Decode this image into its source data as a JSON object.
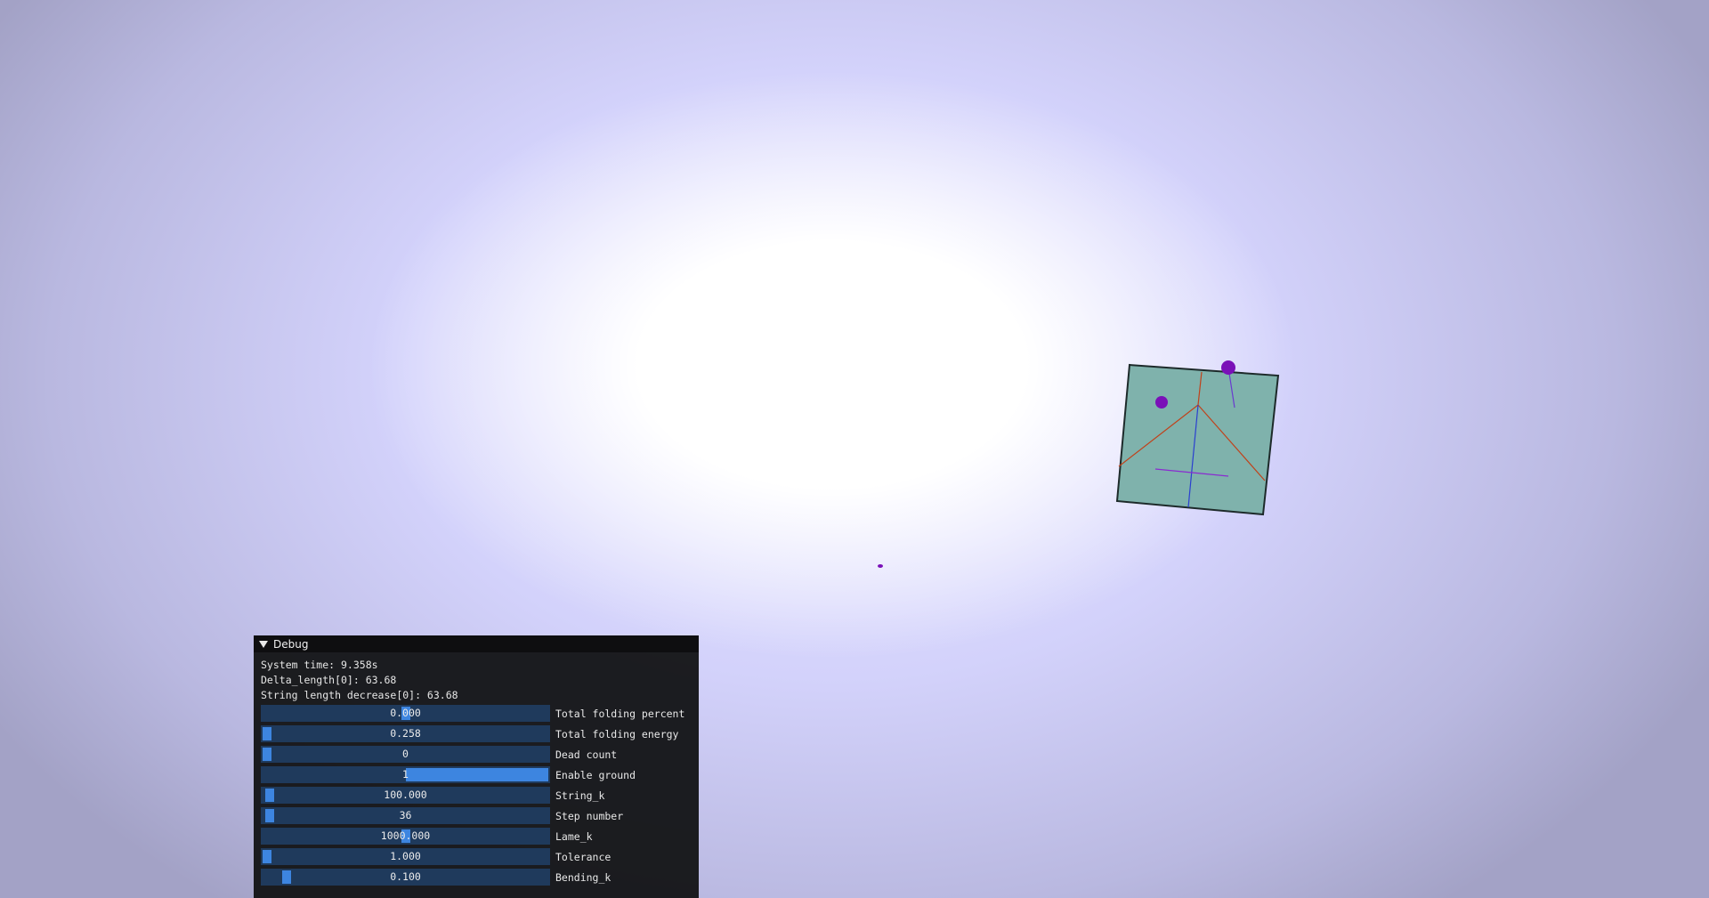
{
  "scene": {
    "background_center": "#ffffff",
    "background_edge": "#a3a2c6",
    "cloth_color": "#7fb2ac",
    "sphere_color": "#7a10b8",
    "fold_line_colors": [
      "#c0421b",
      "#2a3fd0",
      "#8a2bd0"
    ]
  },
  "debug": {
    "title": "Debug",
    "info": {
      "system_time": "System time: 9.358s",
      "delta_length": "Delta_length[0]: 63.68",
      "string_length_decrease": "String length decrease[0]: 63.68"
    },
    "sliders": [
      {
        "label": "Total folding percent",
        "value": "0.000",
        "fill": 0.5
      },
      {
        "label": "Total folding energy",
        "value": "0.258",
        "fill": 0.0
      },
      {
        "label": "Dead count",
        "value": "0",
        "fill": 0.0
      },
      {
        "label": "Enable ground",
        "value": "1",
        "fill": 1.0
      },
      {
        "label": "String_k",
        "value": "100.000",
        "fill": 0.01
      },
      {
        "label": "Step number",
        "value": "36",
        "fill": 0.01
      },
      {
        "label": "Lame_k",
        "value": "1000.000",
        "fill": 0.5
      },
      {
        "label": "Tolerance",
        "value": "1.000",
        "fill": 0.0
      },
      {
        "label": "Bending_k",
        "value": "0.100",
        "fill": 0.07
      }
    ]
  }
}
